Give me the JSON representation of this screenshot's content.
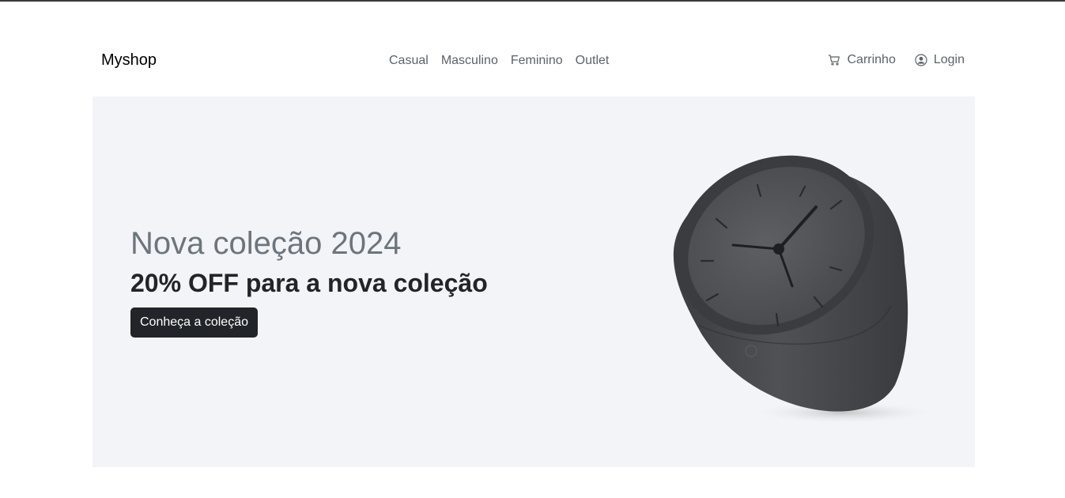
{
  "brand": "Myshop",
  "nav": {
    "links": [
      "Casual",
      "Masculino",
      "Feminino",
      "Outlet"
    ],
    "cart_label": "Carrinho",
    "login_label": "Login"
  },
  "hero": {
    "title": "Nova coleção 2024",
    "subtitle": "20% OFF para a nova coleção",
    "button_label": "Conheça a coleção",
    "image_subject": "dark gray tilted desk clock"
  },
  "colors": {
    "hero_bg": "#f3f4f7",
    "button_bg": "#212529",
    "muted_text": "#6c757d"
  }
}
